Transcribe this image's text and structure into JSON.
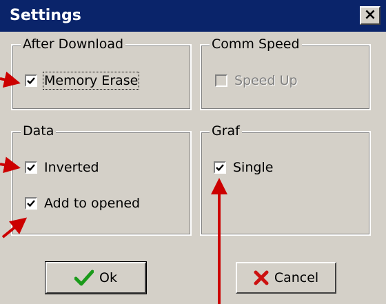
{
  "window": {
    "title": "Settings",
    "close_symbol": "×"
  },
  "groups": {
    "after_download": {
      "label": "After Download",
      "items": [
        {
          "label": "Memory Erase",
          "checked": true
        }
      ]
    },
    "comm_speed": {
      "label": "Comm Speed",
      "items": [
        {
          "label": "Speed Up",
          "checked": false,
          "disabled": true
        }
      ]
    },
    "data": {
      "label": "Data",
      "items": [
        {
          "label": "Inverted",
          "checked": true
        },
        {
          "label": "Add to opened",
          "checked": true
        }
      ]
    },
    "graf": {
      "label": "Graf",
      "items": [
        {
          "label": "Single",
          "checked": true
        }
      ]
    }
  },
  "buttons": {
    "ok_label": "Ok",
    "cancel_label": "Cancel"
  },
  "icons": {
    "ok": "checkmark-icon",
    "cancel": "x-mark-icon"
  },
  "colors": {
    "titlebar": "#0a246a",
    "face": "#d4d0c8",
    "ok_icon": "#1a9a1a",
    "cancel_icon": "#cc1111",
    "arrow": "#cc0000"
  }
}
